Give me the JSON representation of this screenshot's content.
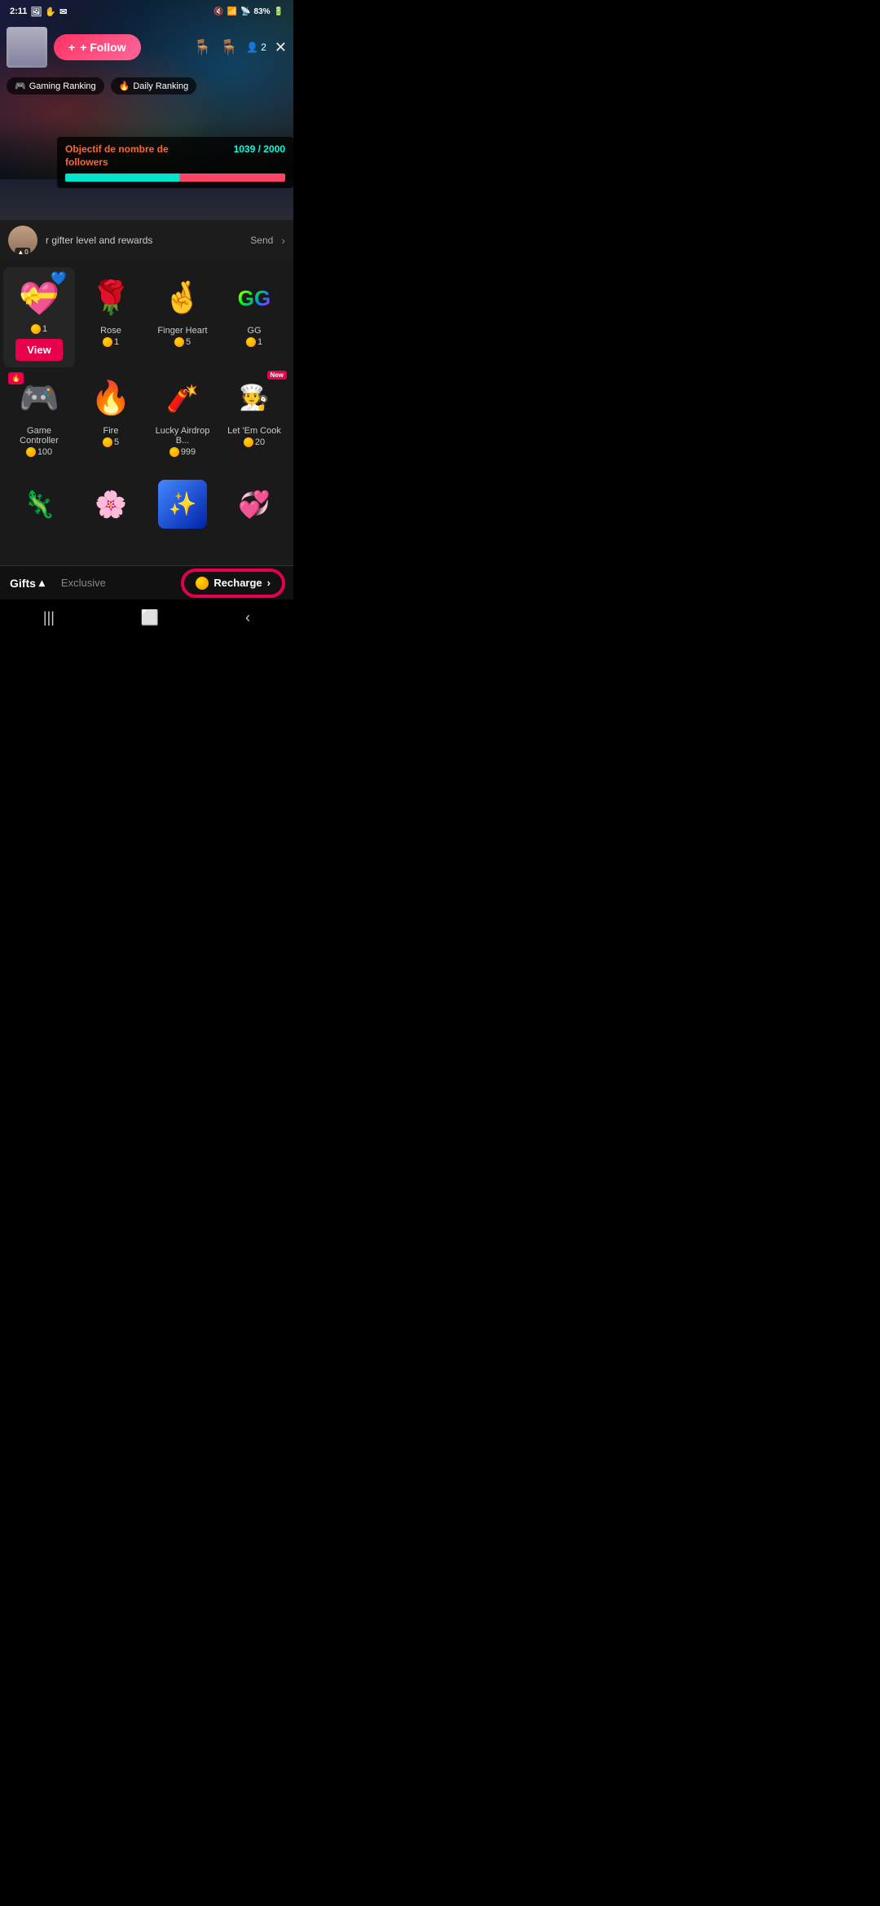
{
  "statusBar": {
    "time": "2:11",
    "battery": "83%",
    "icons": [
      "photo",
      "hand",
      "mail"
    ]
  },
  "topBar": {
    "followLabel": "+ Follow",
    "viewerCount": "2",
    "closeIcon": "✕"
  },
  "rankings": [
    {
      "emoji": "🎮",
      "label": "Gaming Ranking"
    },
    {
      "emoji": "🔥",
      "label": "Daily Ranking"
    }
  ],
  "followerGoal": {
    "title": "Objectif de nombre de\nfollowers",
    "current": "1039",
    "total": "2000",
    "separator": "/"
  },
  "gifterBar": {
    "level": "0",
    "text": "r gifter level and rewards",
    "sendLabel": "Send",
    "arrowIcon": "›"
  },
  "gifts": {
    "bottomBarGiftsLabel": "Gifts",
    "bottomBarDropIcon": "▴",
    "exclusiveLabel": "Exclusive",
    "rechargeLabel": "Recharge",
    "rechargeArrow": "›",
    "items": [
      {
        "id": "heart",
        "emoji": "💝",
        "name": "",
        "price": "1",
        "selected": true,
        "hasBlueFlower": true
      },
      {
        "id": "rose",
        "emoji": "🌹",
        "name": "Rose",
        "price": "1",
        "selected": false
      },
      {
        "id": "finger-heart",
        "emoji": "🤞",
        "name": "Finger Heart",
        "price": "5",
        "selected": false
      },
      {
        "id": "gg",
        "emoji": "GG",
        "name": "GG",
        "price": "1",
        "selected": false
      },
      {
        "id": "gamepad",
        "emoji": "🎮",
        "name": "Game Controller",
        "price": "100",
        "selected": false,
        "hasFireBadge": true
      },
      {
        "id": "fire",
        "emoji": "🔥",
        "name": "Fire",
        "price": "5",
        "selected": false
      },
      {
        "id": "airdrop",
        "emoji": "🧨",
        "name": "Lucky Airdrop B...",
        "price": "999",
        "selected": false
      },
      {
        "id": "cook",
        "emoji": "👨‍🍳",
        "name": "Let 'Em Cook",
        "price": "20",
        "selected": false,
        "isNew": true
      }
    ],
    "bottomItems": [
      {
        "id": "dino",
        "emoji": "🦎"
      },
      {
        "id": "rose2",
        "emoji": "🌸"
      },
      {
        "id": "galaxy",
        "emoji": "✨"
      },
      {
        "id": "heart2",
        "emoji": "💞"
      }
    ]
  }
}
